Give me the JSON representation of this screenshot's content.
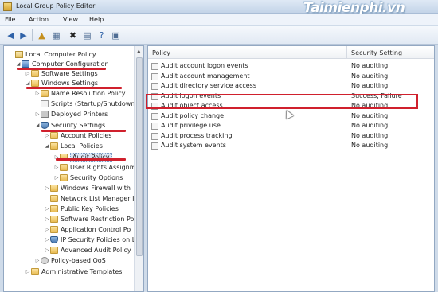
{
  "window": {
    "title": "Local Group Policy Editor",
    "watermark": "Taimienphi.vn"
  },
  "menu": [
    "File",
    "Action",
    "View",
    "Help"
  ],
  "toolbar": {
    "buttons": [
      "back-icon",
      "forward-icon",
      "up-folder-icon",
      "show-hide-tree-icon",
      "delete-icon",
      "properties-icon",
      "help-icon",
      "filter-icon"
    ]
  },
  "tree": [
    {
      "label": "Local Computer Policy",
      "icon": "policy",
      "exp": ""
    },
    {
      "label": "Computer Configuration",
      "icon": "pc",
      "exp": "◢"
    },
    {
      "label": "Software Settings",
      "icon": "folder",
      "exp": "▷"
    },
    {
      "label": "Windows Settings",
      "icon": "folder",
      "exp": "◢"
    },
    {
      "label": "Name Resolution Policy",
      "icon": "folder",
      "exp": "▷"
    },
    {
      "label": "Scripts (Startup/Shutdown",
      "icon": "doc",
      "exp": ""
    },
    {
      "label": "Deployed Printers",
      "icon": "printer",
      "exp": "▷"
    },
    {
      "label": "Security Settings",
      "icon": "shield",
      "exp": "◢"
    },
    {
      "label": "Account Policies",
      "icon": "folder",
      "exp": "▷"
    },
    {
      "label": "Local Policies",
      "icon": "folder",
      "exp": "◢"
    },
    {
      "label": "Audit Policy",
      "icon": "folder",
      "exp": "▷"
    },
    {
      "label": "User Rights Assignm",
      "icon": "folder",
      "exp": "▷"
    },
    {
      "label": "Security Options",
      "icon": "folder",
      "exp": "▷"
    },
    {
      "label": "Windows Firewall with",
      "icon": "folder",
      "exp": "▷"
    },
    {
      "label": "Network List Manager I",
      "icon": "folder",
      "exp": ""
    },
    {
      "label": "Public Key Policies",
      "icon": "folder",
      "exp": "▷"
    },
    {
      "label": "Software Restriction Po",
      "icon": "folder",
      "exp": "▷"
    },
    {
      "label": "Application Control Po",
      "icon": "folder",
      "exp": "▷"
    },
    {
      "label": "IP Security Policies on L",
      "icon": "shield",
      "exp": "▷"
    },
    {
      "label": "Advanced Audit Policy",
      "icon": "folder",
      "exp": "▷"
    },
    {
      "label": "Policy-based QoS",
      "icon": "gear",
      "exp": "▷"
    },
    {
      "label": "Administrative Templates",
      "icon": "folder",
      "exp": "▷"
    }
  ],
  "table": {
    "headers": [
      "Policy",
      "Security Setting"
    ],
    "rows": [
      {
        "policy": "Audit account logon events",
        "setting": "No auditing"
      },
      {
        "policy": "Audit account management",
        "setting": "No auditing"
      },
      {
        "policy": "Audit directory service access",
        "setting": "No auditing"
      },
      {
        "policy": "Audit logon events",
        "setting": "Success, Failure"
      },
      {
        "policy": "Audit object access",
        "setting": "No auditing"
      },
      {
        "policy": "Audit policy change",
        "setting": "No auditing"
      },
      {
        "policy": "Audit privilege use",
        "setting": "No auditing"
      },
      {
        "policy": "Audit process tracking",
        "setting": "No auditing"
      },
      {
        "policy": "Audit system events",
        "setting": "No auditing"
      }
    ]
  },
  "colors": {
    "annotation": "#d0202d",
    "selection": "#dbe7f6"
  }
}
